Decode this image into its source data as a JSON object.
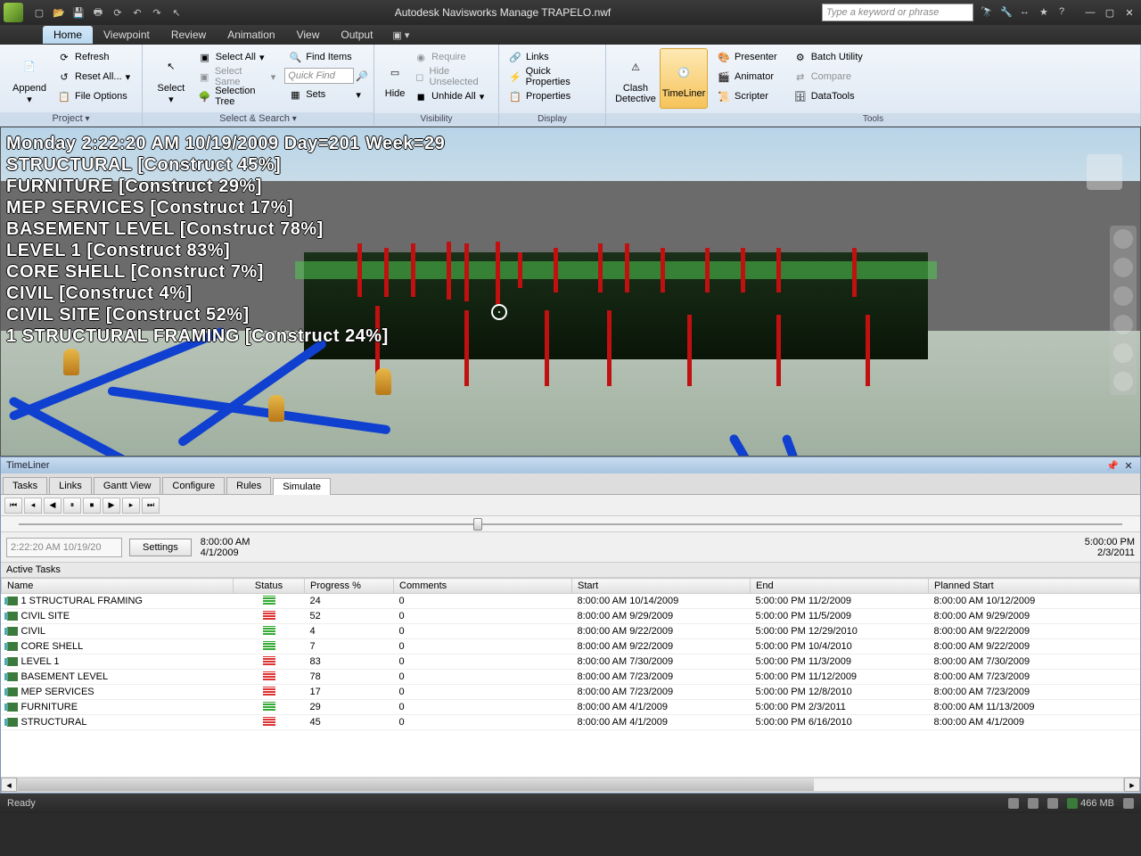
{
  "app": {
    "title": "Autodesk Navisworks Manage    TRAPELO.nwf",
    "search_placeholder": "Type a keyword or phrase"
  },
  "tabs": {
    "home": "Home",
    "viewpoint": "Viewpoint",
    "review": "Review",
    "animation": "Animation",
    "view": "View",
    "output": "Output"
  },
  "ribbon": {
    "project": {
      "append": "Append",
      "refresh": "Refresh",
      "reset_all": "Reset All...",
      "file_options": "File Options",
      "panel": "Project"
    },
    "select": {
      "select": "Select",
      "select_all": "Select All",
      "select_same": "Select Same",
      "selection_tree": "Selection Tree",
      "find_items": "Find Items",
      "quick_find": "Quick Find",
      "sets": "Sets",
      "panel": "Select & Search"
    },
    "visibility": {
      "hide": "Hide",
      "require": "Require",
      "hide_unselected": "Hide Unselected",
      "unhide_all": "Unhide All",
      "panel": "Visibility"
    },
    "display": {
      "links": "Links",
      "quick_properties": "Quick Properties",
      "properties": "Properties",
      "panel": "Display"
    },
    "tools": {
      "clash_detective": "Clash\nDetective",
      "timeliner": "TimeLiner",
      "presenter": "Presenter",
      "animator": "Animator",
      "scripter": "Scripter",
      "batch_utility": "Batch Utility",
      "compare": "Compare",
      "datatools": "DataTools",
      "panel": "Tools"
    }
  },
  "overlay": {
    "line0": "Monday 2:22:20 AM 10/19/2009 Day=201 Week=29",
    "line1": "STRUCTURAL [Construct 45%]",
    "line2": "FURNITURE [Construct 29%]",
    "line3": "MEP SERVICES [Construct 17%]",
    "line4": "BASEMENT LEVEL [Construct 78%]",
    "line5": "LEVEL 1 [Construct 83%]",
    "line6": "CORE SHELL [Construct 7%]",
    "line7": "CIVIL [Construct 4%]",
    "line8": "CIVIL SITE [Construct 52%]",
    "line9": "1 STRUCTURAL FRAMING [Construct 24%]"
  },
  "timeliner": {
    "title": "TimeLiner",
    "tabs": {
      "tasks": "Tasks",
      "links": "Links",
      "gantt": "Gantt View",
      "configure": "Configure",
      "rules": "Rules",
      "simulate": "Simulate"
    },
    "current_time": "2:22:20 AM 10/19/20",
    "settings": "Settings",
    "start_time": "8:00:00 AM",
    "start_date": "4/1/2009",
    "end_time": "5:00:00 PM",
    "end_date": "2/3/2011",
    "active_tasks": "Active Tasks",
    "columns": {
      "name": "Name",
      "status": "Status",
      "progress": "Progress %",
      "comments": "Comments",
      "start": "Start",
      "end": "End",
      "planned_start": "Planned Start"
    },
    "rows": [
      {
        "name": "1 STRUCTURAL FRAMING",
        "status": "green",
        "progress": "24",
        "comments": "0",
        "start": "8:00:00 AM 10/14/2009",
        "end": "5:00:00 PM 11/2/2009",
        "planned": "8:00:00 AM 10/12/2009"
      },
      {
        "name": "CIVIL SITE",
        "status": "red",
        "progress": "52",
        "comments": "0",
        "start": "8:00:00 AM 9/29/2009",
        "end": "5:00:00 PM 11/5/2009",
        "planned": "8:00:00 AM 9/29/2009"
      },
      {
        "name": "CIVIL",
        "status": "green",
        "progress": "4",
        "comments": "0",
        "start": "8:00:00 AM 9/22/2009",
        "end": "5:00:00 PM 12/29/2010",
        "planned": "8:00:00 AM 9/22/2009"
      },
      {
        "name": "CORE SHELL",
        "status": "green",
        "progress": "7",
        "comments": "0",
        "start": "8:00:00 AM 9/22/2009",
        "end": "5:00:00 PM 10/4/2010",
        "planned": "8:00:00 AM 9/22/2009"
      },
      {
        "name": "LEVEL 1",
        "status": "red",
        "progress": "83",
        "comments": "0",
        "start": "8:00:00 AM 7/30/2009",
        "end": "5:00:00 PM 11/3/2009",
        "planned": "8:00:00 AM 7/30/2009"
      },
      {
        "name": "BASEMENT LEVEL",
        "status": "red",
        "progress": "78",
        "comments": "0",
        "start": "8:00:00 AM 7/23/2009",
        "end": "5:00:00 PM 11/12/2009",
        "planned": "8:00:00 AM 7/23/2009"
      },
      {
        "name": "MEP SERVICES",
        "status": "red",
        "progress": "17",
        "comments": "0",
        "start": "8:00:00 AM 7/23/2009",
        "end": "5:00:00 PM 12/8/2010",
        "planned": "8:00:00 AM 7/23/2009"
      },
      {
        "name": "FURNITURE",
        "status": "green",
        "progress": "29",
        "comments": "0",
        "start": "8:00:00 AM 4/1/2009",
        "end": "5:00:00 PM 2/3/2011",
        "planned": "8:00:00 AM 11/13/2009"
      },
      {
        "name": "STRUCTURAL",
        "status": "red",
        "progress": "45",
        "comments": "0",
        "start": "8:00:00 AM 4/1/2009",
        "end": "5:00:00 PM 6/16/2010",
        "planned": "8:00:00 AM 4/1/2009"
      }
    ]
  },
  "statusbar": {
    "ready": "Ready",
    "mem": "466 MB"
  }
}
